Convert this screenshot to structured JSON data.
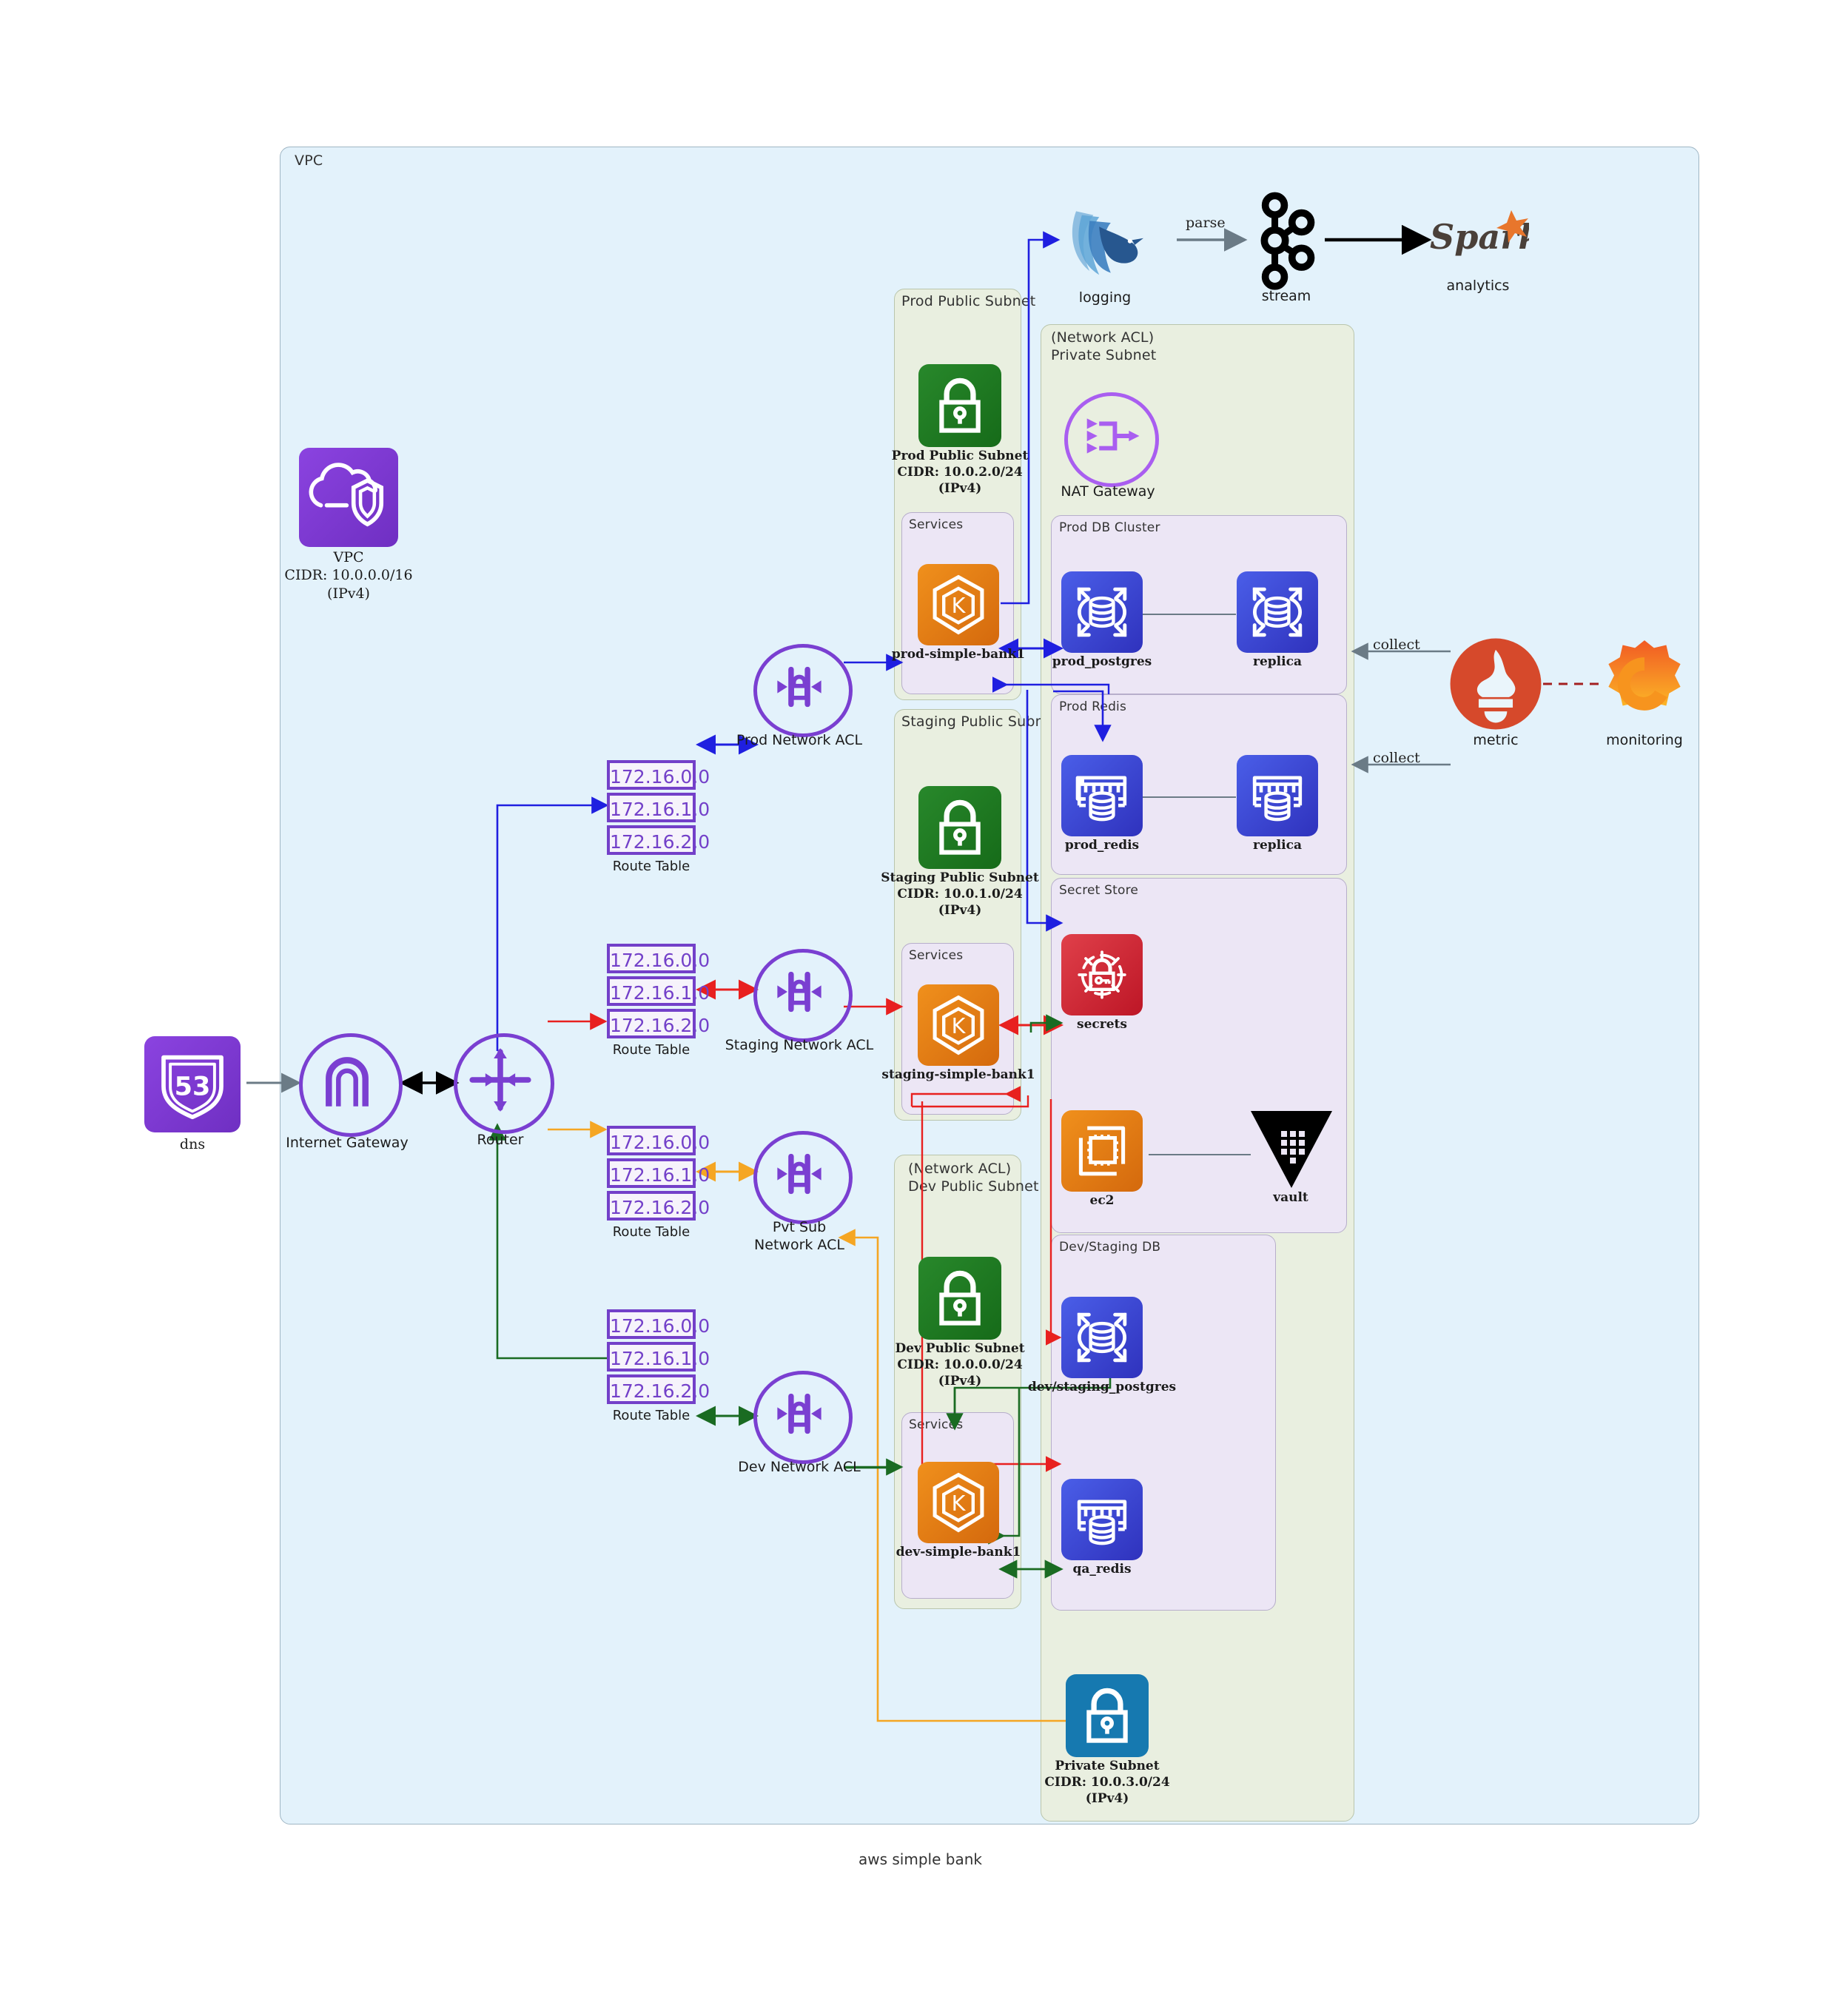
{
  "diagram": {
    "title": "aws simple bank",
    "vpc_label": "VPC"
  },
  "containers": {
    "prod_public_subnet": "Prod Public Subnet",
    "prod_services": "Services",
    "staging_public_subnet": "Staging Public Subnet",
    "staging_services": "Services",
    "private_subnet_acl": "(Network ACL)\nPrivate Subnet",
    "prod_db_cluster": "Prod DB Cluster",
    "prod_redis": "Prod Redis",
    "secret_store": "Secret Store",
    "dev_public_subnet_acl": "(Network ACL)\nDev Public Subnet",
    "dev_services": "Services",
    "dev_staging_db": "Dev/Staging DB"
  },
  "nodes": {
    "vpc": {
      "label": "VPC\nCIDR: 10.0.0.0/16\n(IPv4)",
      "color": "#7d3fcf"
    },
    "dns": {
      "label": "dns",
      "badge": "53",
      "color": "#7d3fcf"
    },
    "internet_gateway": {
      "label": "Internet Gateway",
      "color": "#7a3fd1"
    },
    "router": {
      "label": "Router",
      "color": "#7a3fd1"
    },
    "logging": {
      "label": "logging",
      "color": "#3b73b9"
    },
    "stream": {
      "label": "stream",
      "color": "#000000"
    },
    "analytics": {
      "label": "analytics",
      "color": "#e25a1c"
    },
    "nat_gateway": {
      "label": "NAT Gateway",
      "color": "#a95ef0"
    },
    "prod_public_subnet_node": {
      "label": "Prod Public Subnet\nCIDR: 10.0.2.0/24\n(IPv4)",
      "color": "#1e8324"
    },
    "prod_simple_bank1": {
      "label": "prod-simple-bank1",
      "color": "#ea8215"
    },
    "prod_postgres": {
      "label": "prod_postgres",
      "color": "#3b48d6"
    },
    "prod_postgres_replica": {
      "label": "replica",
      "color": "#3b48d6"
    },
    "prod_redis_node": {
      "label": "prod_redis",
      "color": "#3b48d6"
    },
    "prod_redis_replica": {
      "label": "replica",
      "color": "#3b48d6"
    },
    "staging_public_subnet_node": {
      "label": "Staging Public Subnet\nCIDR: 10.0.1.0/24\n(IPv4)",
      "color": "#1e8324"
    },
    "staging_simple_bank1": {
      "label": "staging-simple-bank1",
      "color": "#ea8215"
    },
    "secrets": {
      "label": "secrets",
      "color": "#d32030"
    },
    "ec2": {
      "label": "ec2",
      "color": "#ea8215"
    },
    "vault": {
      "label": "vault",
      "color": "#000000"
    },
    "dev_public_subnet_node": {
      "label": "Dev Public Subnet\nCIDR: 10.0.0.0/24\n(IPv4)",
      "color": "#1e8324"
    },
    "dev_simple_bank1": {
      "label": "dev-simple-bank1",
      "color": "#ea8215"
    },
    "dev_staging_postgres": {
      "label": "dev/staging_postgres",
      "color": "#3b48d6"
    },
    "qa_redis": {
      "label": "qa_redis",
      "color": "#3b48d6"
    },
    "private_subnet_node": {
      "label": "Private Subnet\nCIDR: 10.0.3.0/24\n(IPv4)",
      "color": "#1577ad"
    },
    "metric": {
      "label": "metric",
      "color": "#d6492b"
    },
    "monitoring": {
      "label": "monitoring",
      "color": "#f46800"
    },
    "prod_network_acl": {
      "label": "Prod Network ACL",
      "color": "#7a3fd1"
    },
    "staging_network_acl": {
      "label": "Staging Network ACL",
      "color": "#7a3fd1"
    },
    "pvt_sub_network_acl": {
      "label": "Pvt Sub\nNetwork ACL",
      "color": "#7a3fd1"
    },
    "dev_network_acl": {
      "label": "Dev Network ACL",
      "color": "#7a3fd1"
    }
  },
  "route_tables": [
    {
      "name": "prod-route-table",
      "label": "Route Table",
      "rows": [
        "172.16.0.0",
        "172.16.1.0",
        "172.16.2.0"
      ]
    },
    {
      "name": "staging-route-table",
      "label": "Route Table",
      "rows": [
        "172.16.0.0",
        "172.16.1.0",
        "172.16.2.0"
      ]
    },
    {
      "name": "pvt-route-table",
      "label": "Route Table",
      "rows": [
        "172.16.0.0",
        "172.16.1.0",
        "172.16.2.0"
      ]
    },
    {
      "name": "dev-route-table",
      "label": "Route Table",
      "rows": [
        "172.16.0.0",
        "172.16.1.0",
        "172.16.2.0"
      ]
    }
  ],
  "edge_labels": {
    "parse": "parse",
    "collect_db": "collect",
    "collect_redis": "collect"
  },
  "colors": {
    "vpc_fill": "#e3f2fb",
    "subnet_fill": "#e9efe0",
    "group_fill": "#ece6f5",
    "prod_flow": "#1f1fe0",
    "staging_flow": "#e8201f",
    "dev_flow": "#1a6b22",
    "pvt_flow": "#f5a623",
    "neutral_flow": "#6b7b86",
    "accent_purple": "#7a3fd1"
  }
}
